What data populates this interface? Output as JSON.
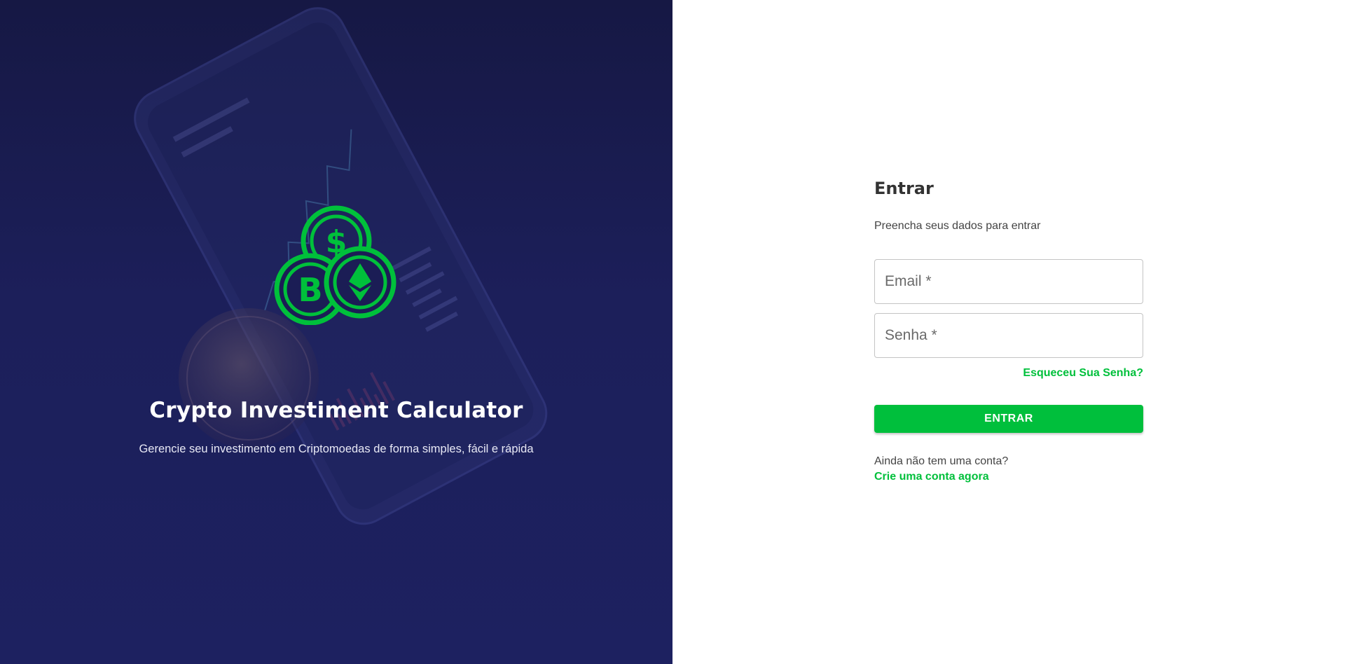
{
  "hero": {
    "title": "Crypto Investiment Calculator",
    "subtitle": "Gerencie seu investimento em Criptomoedas de forma simples, fácil e rápida",
    "logo_icon": "crypto-coins-icon",
    "background_image": "phone-trading-chart-with-bitcoin-coin"
  },
  "login": {
    "title": "Entrar",
    "subtitle": "Preencha seus dados para entrar",
    "email_placeholder": "Email *",
    "password_placeholder": "Senha *",
    "forgot_password": "Esqueceu Sua Senha?",
    "submit_label": "ENTRAR",
    "no_account_text": "Ainda não tem uma conta?",
    "signup_link": "Crie uma conta agora"
  },
  "colors": {
    "hero_background": "#1c1f5a",
    "accent_green": "#00bf3c",
    "title_text": "#333333",
    "white": "#ffffff"
  }
}
